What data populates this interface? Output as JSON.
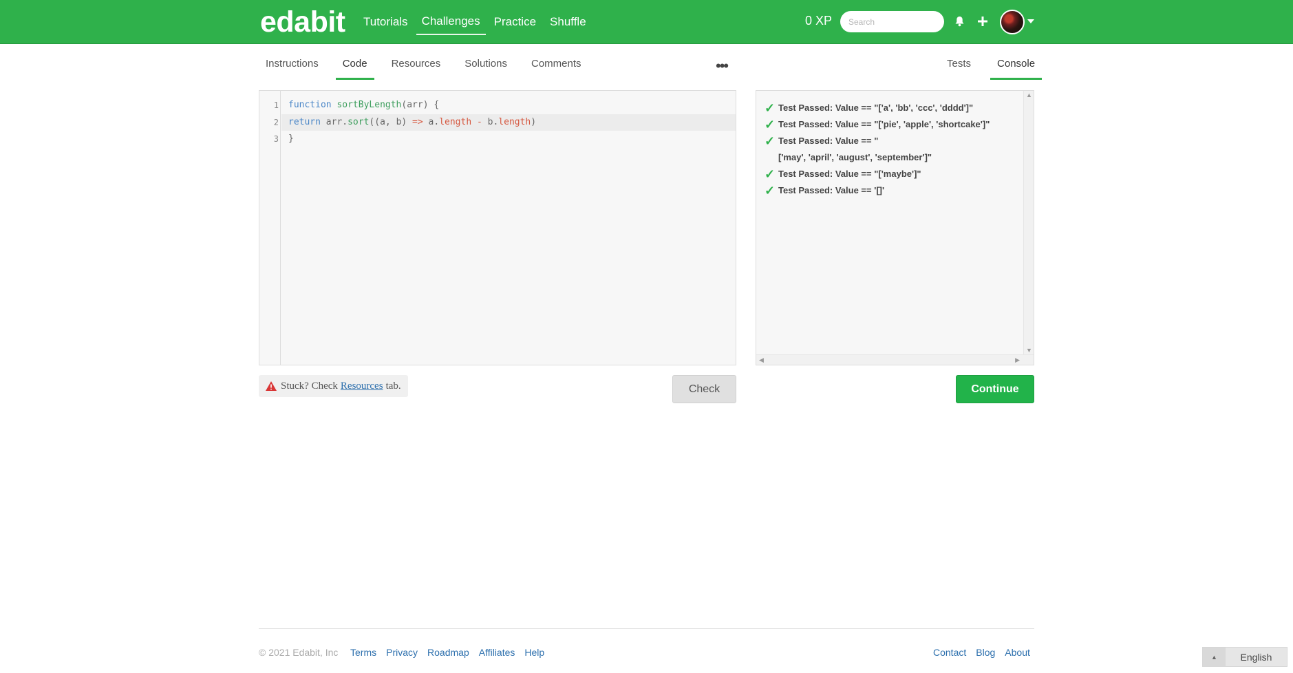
{
  "header": {
    "logo": "edabit",
    "nav": [
      "Tutorials",
      "Challenges",
      "Practice",
      "Shuffle"
    ],
    "active_nav": "Challenges",
    "xp": "0 XP",
    "search_placeholder": "Search",
    "icons": [
      "bell-icon",
      "plus-icon",
      "avatar",
      "chevron-down-icon"
    ]
  },
  "tabs": {
    "left": [
      "Instructions",
      "Code",
      "Resources",
      "Solutions",
      "Comments"
    ],
    "left_active": "Code",
    "more": "•••",
    "right": [
      "Tests",
      "Console"
    ],
    "right_active": "Console"
  },
  "editor": {
    "line_numbers": [
      "1",
      "2",
      "3"
    ],
    "lines": [
      "function sortByLength(arr) {",
      "return arr.sort((a, b) => a.length - b.length)",
      "}"
    ],
    "highlighted_line": 2
  },
  "console": {
    "results": [
      {
        "text": "Test Passed: Value == \"['a', 'bb', 'ccc', 'dddd']\""
      },
      {
        "text": "Test Passed: Value == \"['pie', 'apple', 'shortcake']\""
      },
      {
        "text": "Test Passed: Value == \"",
        "cont": "['may', 'april', 'august', 'september']\""
      },
      {
        "text": "Test Passed: Value == \"['maybe']\""
      },
      {
        "text": "Test Passed: Value == '[]'"
      }
    ],
    "status_icon": "checkmark-icon",
    "status_color": "#2fb14b"
  },
  "actions": {
    "stuck_prefix": "Stuck? Check",
    "stuck_link": "Resources",
    "stuck_suffix": "tab.",
    "check_label": "Check",
    "continue_label": "Continue"
  },
  "footer": {
    "copyright": "© 2021 Edabit, Inc",
    "links_left": [
      "Terms",
      "Privacy",
      "Roadmap",
      "Affiliates",
      "Help"
    ],
    "links_right": [
      "Contact",
      "Blog",
      "About"
    ],
    "language": "English"
  },
  "colors": {
    "brand_green": "#2fb14b",
    "continue_green": "#22b34a",
    "link_blue": "#2c6fad"
  }
}
